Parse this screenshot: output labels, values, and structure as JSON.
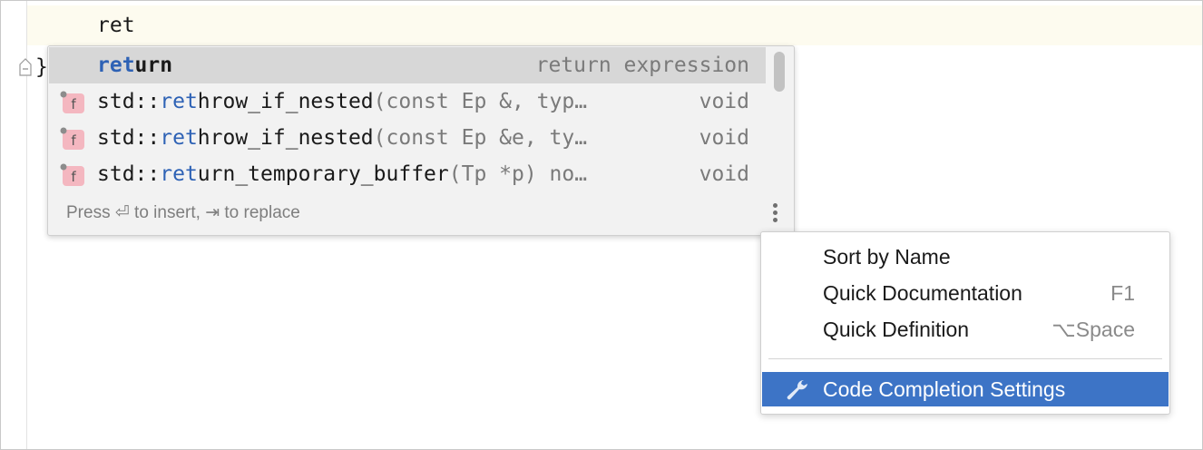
{
  "editor": {
    "typed_text": "ret",
    "closing_brace": "}"
  },
  "completion": {
    "items": [
      {
        "match": "ret",
        "rest": "urn",
        "args": "",
        "type": "return expression",
        "icon": "keyword"
      },
      {
        "prefix": "std::",
        "match": "ret",
        "rest": "hrow_if_nested",
        "args": "(const Ep &, typ…",
        "type": "void",
        "icon": "function-icon"
      },
      {
        "prefix": "std::",
        "match": "ret",
        "rest": "hrow_if_nested",
        "args": "(const Ep &e, ty…",
        "type": "void",
        "icon": "function-icon"
      },
      {
        "prefix": "std::",
        "match": "ret",
        "rest": "urn_temporary_buffer",
        "args": "(Tp *p) no…",
        "type": "void",
        "icon": "function-icon"
      }
    ],
    "icon_letter": "f",
    "hint": "Press ⏎ to insert, ⇥ to replace"
  },
  "menu": {
    "items": [
      {
        "label": "Sort by Name",
        "shortcut": ""
      },
      {
        "label": "Quick Documentation",
        "shortcut": "F1"
      },
      {
        "label": "Quick Definition",
        "shortcut": "⌥Space"
      }
    ],
    "settings_label": "Code Completion Settings"
  },
  "colors": {
    "match_highlight": "#2e62b5",
    "selection": "#3d74c6",
    "icon_bg": "#f4b7c0"
  }
}
